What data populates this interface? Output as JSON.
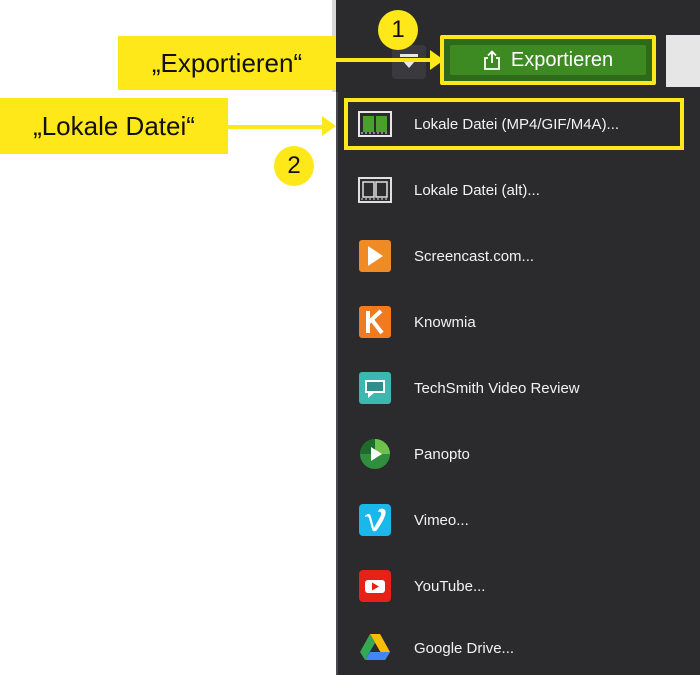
{
  "toolbar": {
    "export_label": "Exportieren"
  },
  "menu": {
    "items": [
      {
        "label": "Lokale Datei (MP4/GIF/M4A)...",
        "icon": "film-strip-icon",
        "color": "#4aa02a"
      },
      {
        "label": "Lokale Datei (alt)...",
        "icon": "film-strip-outline-icon",
        "color": "#d8d8d8"
      },
      {
        "label": "Screencast.com...",
        "icon": "screencast-icon",
        "color": "#f08a24"
      },
      {
        "label": "Knowmia",
        "icon": "knowmia-icon",
        "color": "#f07a20"
      },
      {
        "label": "TechSmith Video Review",
        "icon": "techsmith-video-review-icon",
        "color": "#3bb8b0"
      },
      {
        "label": "Panopto",
        "icon": "panopto-icon",
        "color": "#3aa64a"
      },
      {
        "label": "Vimeo...",
        "icon": "vimeo-icon",
        "color": "#1ab7ea"
      },
      {
        "label": "YouTube...",
        "icon": "youtube-icon",
        "color": "#e62117"
      },
      {
        "label": "Google Drive...",
        "icon": "google-drive-icon",
        "color": "#34a853"
      }
    ]
  },
  "annotations": {
    "callout_export": "„Exportieren“",
    "callout_local_file": "„Lokale Datei“",
    "badge_1": "1",
    "badge_2": "2"
  },
  "colors": {
    "highlight": "#ffe81a",
    "export_green": "#3d8a22",
    "menu_bg": "#2b2b2e"
  }
}
